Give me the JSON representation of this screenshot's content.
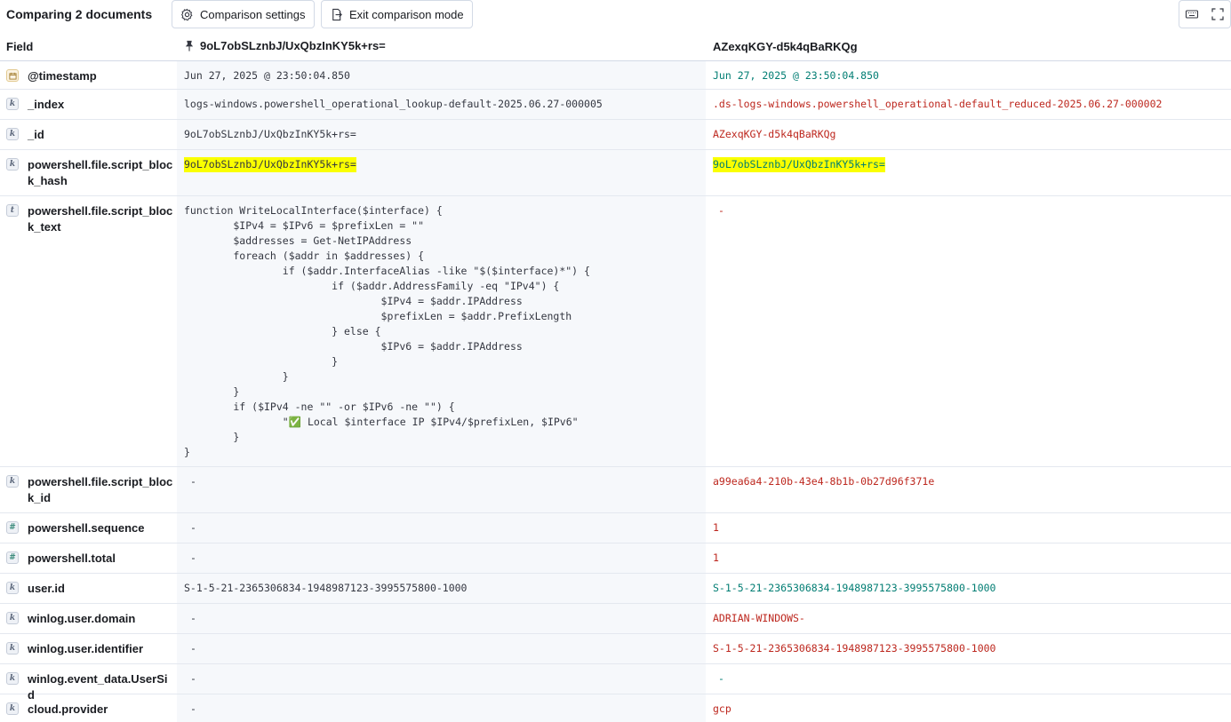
{
  "toolbar": {
    "title": "Comparing 2 documents",
    "settings_label": "Comparison settings",
    "exit_label": "Exit comparison mode"
  },
  "header": {
    "field": "Field",
    "doc_a": "9oL7obSLznbJ/UxQbzInKY5k+rs=",
    "doc_b": "AZexqKGY-d5k4qBaRKQg"
  },
  "rows": [
    {
      "type": "date",
      "field": "@timestamp",
      "a": "Jun 27, 2025 @ 23:50:04.850",
      "b": "Jun 27, 2025 @ 23:50:04.850",
      "b_status": "same"
    },
    {
      "type": "k",
      "field": "_index",
      "a": "logs-windows.powershell_operational_lookup-default-2025.06.27-000005",
      "b": ".ds-logs-windows.powershell_operational-default_reduced-2025.06.27-000002",
      "b_status": "diff"
    },
    {
      "type": "k",
      "field": "_id",
      "a": "9oL7obSLznbJ/UxQbzInKY5k+rs=",
      "b": "AZexqKGY-d5k4qBaRKQg",
      "b_status": "diff"
    },
    {
      "type": "k",
      "field": "powershell.file.script_block_hash",
      "a": "9oL7obSLznbJ/UxQbzInKY5k+rs=",
      "b": "9oL7obSLznbJ/UxQbzInKY5k+rs=",
      "b_status": "same"
    },
    {
      "type": "t",
      "field": "powershell.file.script_block_text",
      "a": "function WriteLocalInterface($interface) {\n        $IPv4 = $IPv6 = $prefixLen = \"\"\n        $addresses = Get-NetIPAddress\n        foreach ($addr in $addresses) {\n                if ($addr.InterfaceAlias -like \"$($interface)*\") {\n                        if ($addr.AddressFamily -eq \"IPv4\") {\n                                $IPv4 = $addr.IPAddress\n                                $prefixLen = $addr.PrefixLength\n                        } else {\n                                $IPv6 = $addr.IPAddress\n                        }\n                }\n        }\n        if ($IPv4 -ne \"\" -or $IPv6 -ne \"\") {\n                \"✅ Local $interface IP $IPv4/$prefixLen, $IPv6\"\n        }\n}",
      "b": "-",
      "b_status": "diff"
    },
    {
      "type": "k",
      "field": "powershell.file.script_block_id",
      "a": "-",
      "b": "a99ea6a4-210b-43e4-8b1b-0b27d96f371e",
      "b_status": "diff"
    },
    {
      "type": "num",
      "field": "powershell.sequence",
      "a": "-",
      "b": "1",
      "b_status": "diff"
    },
    {
      "type": "num",
      "field": "powershell.total",
      "a": "-",
      "b": "1",
      "b_status": "diff"
    },
    {
      "type": "k",
      "field": "user.id",
      "a": "S-1-5-21-2365306834-1948987123-3995575800-1000",
      "b": "S-1-5-21-2365306834-1948987123-3995575800-1000",
      "b_status": "same"
    },
    {
      "type": "k",
      "field": "winlog.user.domain",
      "a": "-",
      "b": "ADRIAN-WINDOWS-",
      "b_status": "diff"
    },
    {
      "type": "k",
      "field": "winlog.user.identifier",
      "a": "-",
      "b": "S-1-5-21-2365306834-1948987123-3995575800-1000",
      "b_status": "diff"
    },
    {
      "type": "k",
      "field": "winlog.event_data.UserSid",
      "a": "-",
      "b": "-",
      "b_status": "same"
    },
    {
      "type": "k",
      "field": "cloud.provider",
      "a": "-",
      "b": "gcp",
      "b_status": "diff"
    }
  ],
  "icons": {
    "settings": "gear-icon",
    "exit": "exit-icon",
    "keyboard": "keyboard-icon",
    "fullscreen": "fullscreen-icon",
    "pin": "pin-icon"
  },
  "colors": {
    "diff": "#bd271e",
    "same": "#017d73",
    "highlight": "#faff00"
  }
}
